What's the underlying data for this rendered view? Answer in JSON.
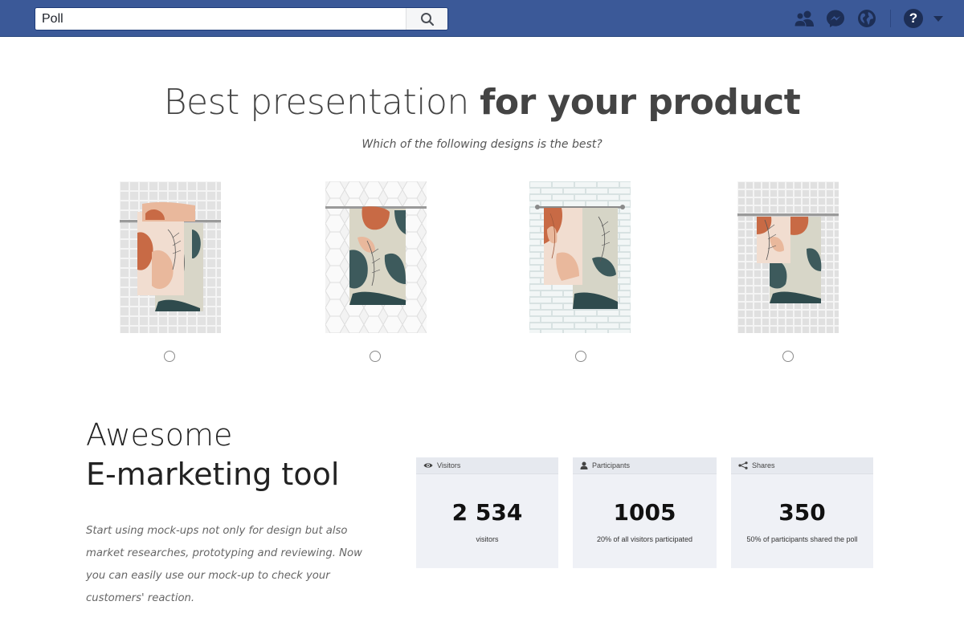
{
  "topbar": {
    "search_value": "Poll",
    "icons": [
      "friends-icon",
      "messenger-icon",
      "globe-icon",
      "help-icon",
      "dropdown-arrow-icon"
    ],
    "help_label": "?"
  },
  "headline": {
    "light": "Best presentation",
    "bold": "for your product"
  },
  "subhead": "Which of the following designs is the best?",
  "options": [
    {
      "id": "design-1"
    },
    {
      "id": "design-2"
    },
    {
      "id": "design-3"
    },
    {
      "id": "design-4"
    }
  ],
  "marketing": {
    "title_line1": "Awesome",
    "title_line2": "E-marketing tool",
    "description": "Start using mock-ups not only for design but also market researches, prototyping and reviewing. Now you can easily use our mock-up to check your customers' reaction."
  },
  "stats": {
    "visitors": {
      "label": "Visitors",
      "value": "2 534",
      "note": "visitors"
    },
    "participants": {
      "label": "Participants",
      "value": "1005",
      "note": "20% of all visitors participated"
    },
    "shares": {
      "label": "Shares",
      "value": "350",
      "note": "50% of participants shared the poll"
    }
  },
  "colors": {
    "topbar": "#3b5998",
    "card_bg": "#eff1f6",
    "towel_orange": "#c86a45",
    "towel_peach": "#e9b89c",
    "towel_teal": "#3d5a5c",
    "towel_sage": "#d8d6c8"
  }
}
